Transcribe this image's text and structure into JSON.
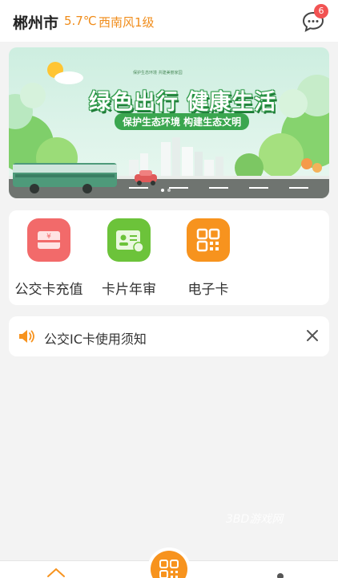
{
  "header": {
    "city": "郴州市",
    "temperature": "5.7℃",
    "wind": "西南风1级",
    "message_count": "6"
  },
  "banner": {
    "top_text": "保护生态环境 共建美丽家园",
    "title": "绿色出行 健康生活",
    "subtitle": "保护生态环境 构建生态文明"
  },
  "menu": {
    "items": [
      {
        "label": "公交卡充值",
        "icon": "card-recharge-icon",
        "color": "#f26a6a"
      },
      {
        "label": "卡片年审",
        "icon": "card-review-icon",
        "color": "#6cc33a"
      },
      {
        "label": "电子卡",
        "icon": "qr-code-icon",
        "color": "#f7931e"
      }
    ]
  },
  "notice": {
    "text": "公交IC卡使用须知"
  },
  "watermark": "3BD游戏网",
  "colors": {
    "accent": "#f08c1a",
    "badge": "#f25353"
  }
}
